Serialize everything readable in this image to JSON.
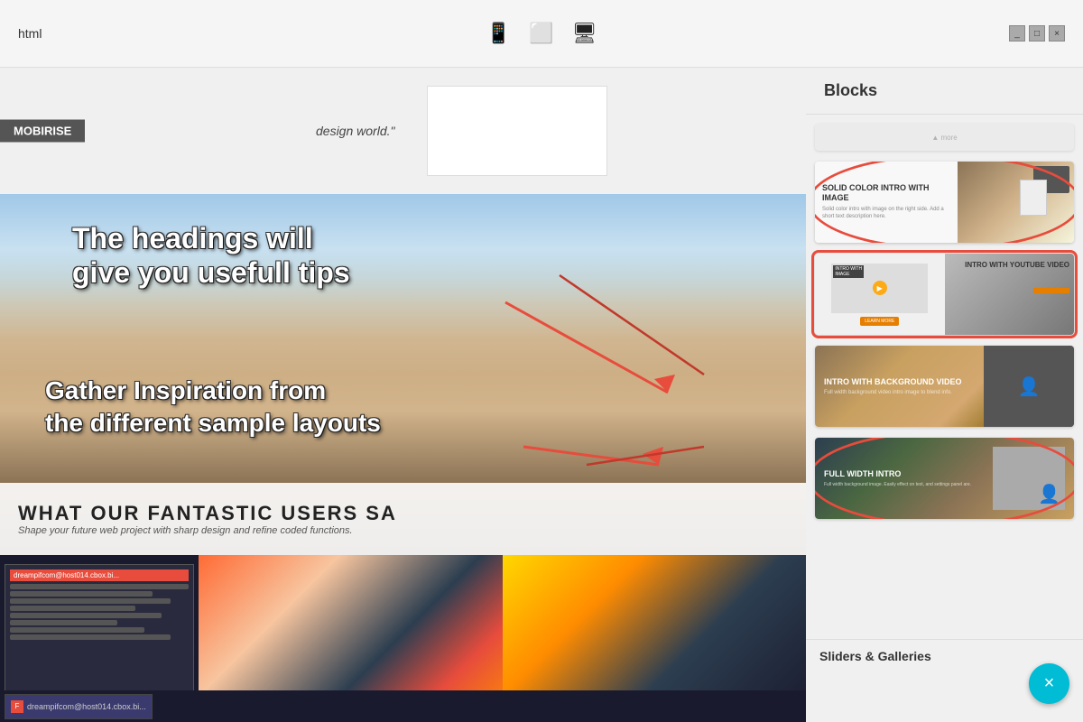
{
  "titlebar": {
    "title": "html",
    "icons": {
      "mobile": "📱",
      "tablet": "⬜",
      "desktop": "🖥"
    },
    "window_controls": [
      "_",
      "□",
      "×"
    ]
  },
  "preview": {
    "logo": "MOBIRISE",
    "quote": "design world.\"",
    "annotation1": "The headings will give you usefull tips",
    "annotation2": "Gather Inspiration from the different sample layouts",
    "testimonials_heading": "WHAT OUR FANTASTIC USERS SA",
    "testimonials_sub": "Shape your future web project with sharp design and refine coded functions.",
    "chat_header": "dreampifcom@host014.cbox.bi..."
  },
  "blocks_panel": {
    "header": "Blocks",
    "items": [
      {
        "id": "block1",
        "title": "SOLID COLOR INTRO WITH IMAGE",
        "description": "Solid color intro with image on the right side. Add a short text description here.",
        "highlighted": false
      },
      {
        "id": "block2",
        "title": "INTRO WITH YOUTUBE VIDEO",
        "highlighted": true
      },
      {
        "id": "block3",
        "title": "INTRO WITH BACKGROUND VIDEO",
        "description": "Full width background video intro image to blend info.",
        "highlighted": false
      },
      {
        "id": "block4",
        "title": "FULL WIDTH INTRO",
        "description": "Full width background image. Easily effect on text, and settings panel are.",
        "highlighted": false
      }
    ],
    "section_label": "Sliders & Galleries"
  },
  "taskbar": {
    "items": [
      {
        "label": "dreampifcom@host014.cbox.bi...",
        "active": true
      }
    ]
  },
  "colors": {
    "accent_red": "#e74c3c",
    "accent_orange": "#e67e00",
    "accent_cyan": "#00bcd4",
    "dark_bg": "#1a1a2e"
  }
}
